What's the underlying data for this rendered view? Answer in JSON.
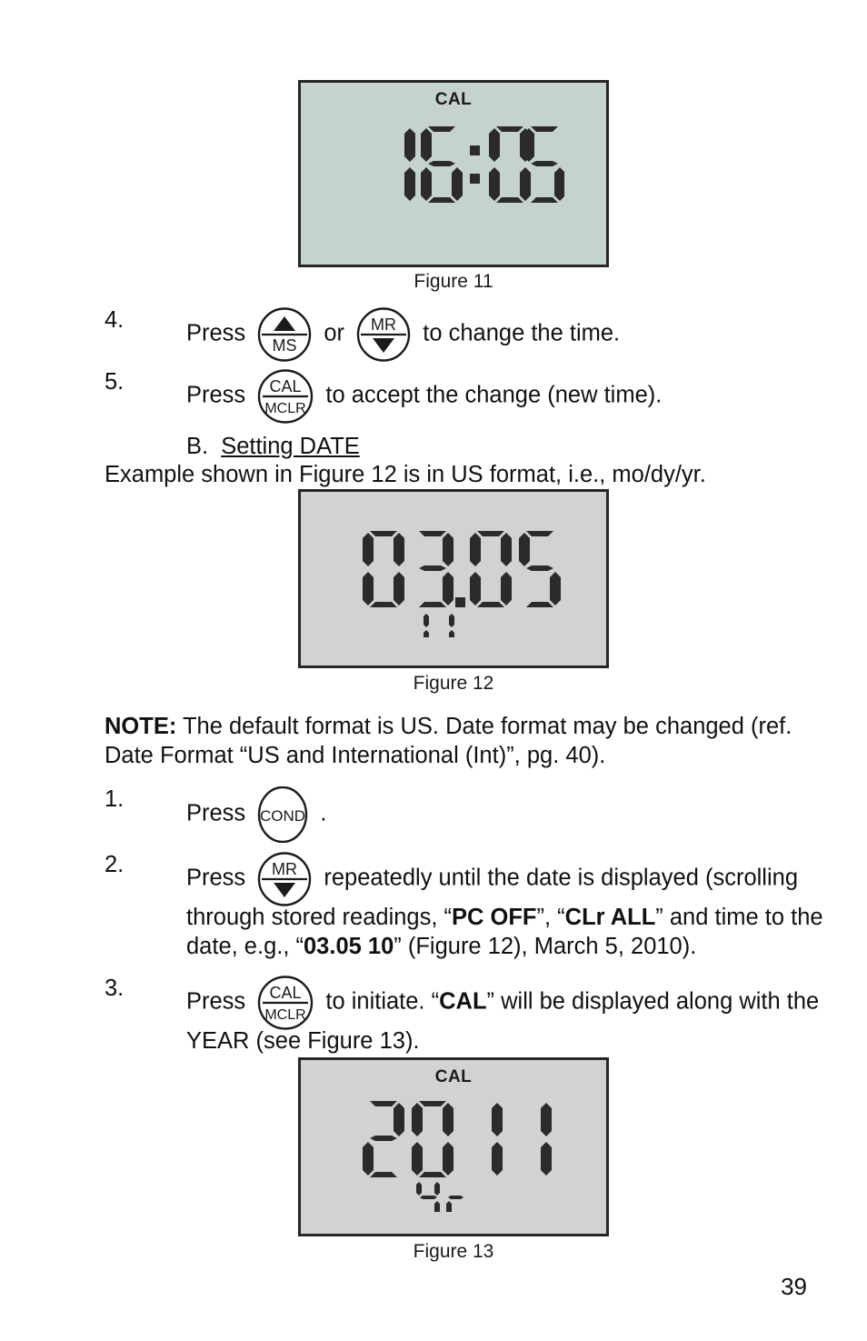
{
  "page": {
    "number": "39"
  },
  "figures": {
    "fig11": {
      "caption": "Figure 11",
      "cal_label": "CAL",
      "display": "16:05",
      "sub_display": "",
      "background": "#c6d2ce"
    },
    "fig12": {
      "caption": "Figure 12",
      "cal_label": "",
      "display": "03.05",
      "sub_display": "11",
      "background": "#d2d2d2"
    },
    "fig13": {
      "caption": "Figure 13",
      "cal_label": "CAL",
      "display": "2011",
      "sub_display": "yr",
      "background": "#d2d2d2"
    }
  },
  "keys": {
    "ms": {
      "top": "▲",
      "bottom": "MS",
      "divider": true
    },
    "mr": {
      "top": "MR",
      "bottom": "▼",
      "divider": true
    },
    "cal_mclr": {
      "top": "CAL",
      "bottom": "MCLR",
      "divider": true
    },
    "cond": {
      "top": "COND",
      "bottom": "",
      "divider": false
    }
  },
  "steps": {
    "step4": {
      "number": "4.",
      "press": "Press",
      "or": "or",
      "tail": "to change the time."
    },
    "step5": {
      "number": "5.",
      "press": "Press",
      "tail": "to accept the change (new time)."
    },
    "step_b": {
      "letter": "B.",
      "title": "Setting DATE",
      "intro": "Example shown in Figure 12 is in US format, i.e., mo/dy/yr."
    },
    "note": {
      "label": "NOTE:",
      "line1": " The default format is US. Date format may be changed (ref.",
      "line2": "Date Format “US and International (Int)”, pg. 40)."
    },
    "step1": {
      "number": "1.",
      "press": "Press",
      "tail": "."
    },
    "step2": {
      "number": "2.",
      "press": "Press",
      "tail": "repeatedly until the date is displayed (scrolling",
      "line2_a": "through stored readings, “",
      "line2_b": "PC OFF",
      "line2_c": "”, “",
      "line2_d": "CLr ALL",
      "line2_e": "” and time to the",
      "line3_a": "date, e.g., “",
      "line3_b": "03.05 10",
      "line3_c": "” (Figure 12), March 5, 2010)."
    },
    "step3": {
      "number": "3.",
      "press": "Press",
      "tail_a": "to initiate. “",
      "tail_b": "CAL",
      "tail_c": "” will be displayed along with the",
      "line2": "YEAR (see Figure 13)."
    }
  }
}
